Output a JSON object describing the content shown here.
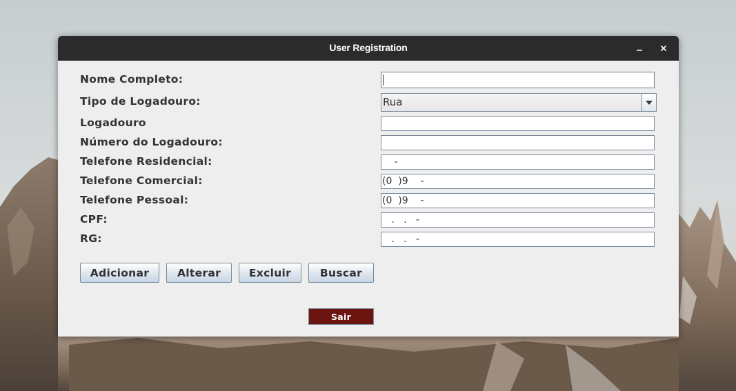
{
  "window": {
    "title": "User Registration"
  },
  "form": {
    "fields": [
      {
        "label": "Nome Completo:",
        "value": ""
      },
      {
        "label": "Tipo de Logadouro:",
        "value": "Rua",
        "control": "select"
      },
      {
        "label": "Logadouro",
        "value": ""
      },
      {
        "label": "Número do Logadouro:",
        "value": ""
      },
      {
        "label": "Telefone Residencial:",
        "value": "    -"
      },
      {
        "label": "Telefone Comercial:",
        "value": "(0  )9    -"
      },
      {
        "label": "Telefone Pessoal:",
        "value": "(0  )9    -"
      },
      {
        "label": "CPF:",
        "value": "   .   .   -"
      },
      {
        "label": "RG:",
        "value": "   .   .   -"
      }
    ]
  },
  "buttons": {
    "add": "Adicionar",
    "edit": "Alterar",
    "delete": "Excluir",
    "search": "Buscar",
    "exit": "Sair"
  },
  "colors": {
    "titlebar": "#2b2b2b",
    "window_bg": "#eeeeee",
    "exit_button": "#6b1410"
  },
  "icons": {
    "minimize": "minimize-icon",
    "close": "close-icon",
    "dropdown": "chevron-down-icon"
  }
}
